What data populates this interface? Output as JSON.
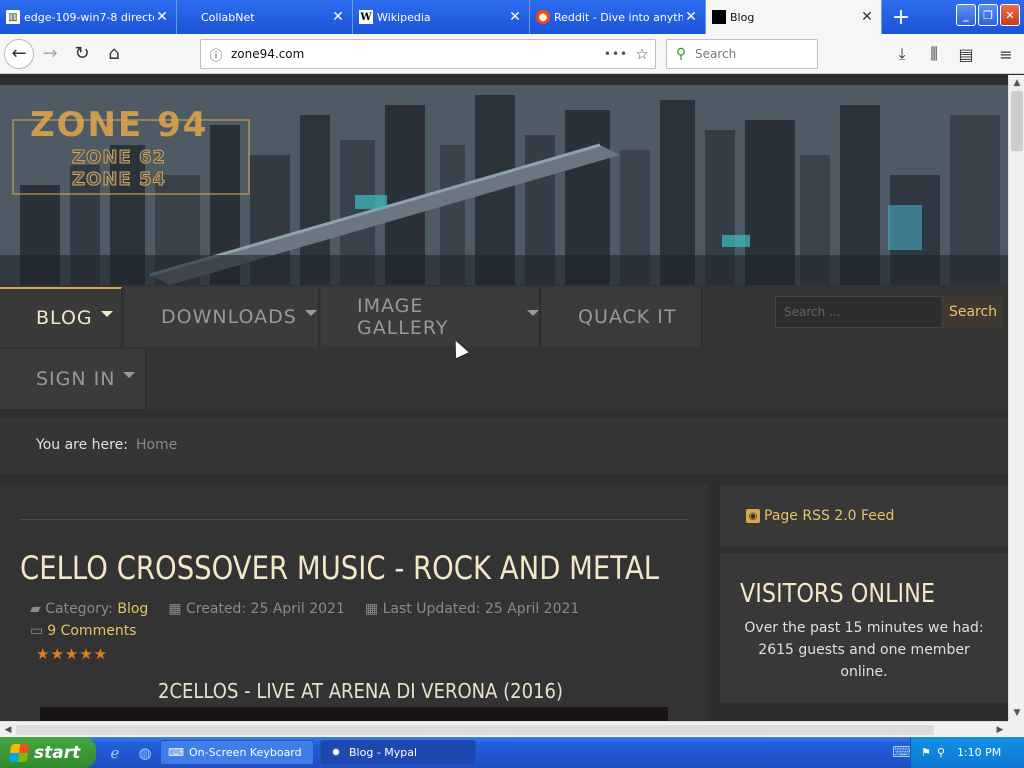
{
  "tabs": [
    {
      "label": "edge-109-win7-8 directo",
      "icon": "library-icon",
      "active": false
    },
    {
      "label": "CollabNet",
      "icon": "blank-page-icon",
      "active": false
    },
    {
      "label": "Wikipedia",
      "icon": "wikipedia-icon",
      "active": false
    },
    {
      "label": "Reddit - Dive into anyth",
      "icon": "reddit-icon",
      "active": false
    },
    {
      "label": "Blog",
      "icon": "black-square-icon",
      "active": true
    }
  ],
  "navbar": {
    "url": "zone94.com",
    "search_placeholder": "Search"
  },
  "banner": {
    "logo_main": "ZONE 94",
    "logo_sub_1": "ZONE 62",
    "logo_sub_2": "ZONE 54"
  },
  "menu": {
    "items": [
      {
        "label": "BLOG",
        "has_caret": true,
        "active": true
      },
      {
        "label": "DOWNLOADS",
        "has_caret": true,
        "active": false
      },
      {
        "label": "IMAGE GALLERY",
        "has_caret": true,
        "active": false
      },
      {
        "label": "QUACK IT",
        "has_caret": false,
        "active": false
      },
      {
        "label": "SIGN IN",
        "has_caret": true,
        "active": false
      }
    ],
    "search_placeholder": "Search ...",
    "search_button": "Search"
  },
  "breadcrumb": {
    "prefix": "You are here:",
    "home": "Home"
  },
  "article": {
    "title": "CELLO CROSSOVER MUSIC - ROCK AND METAL",
    "category_label": "Category:",
    "category": "Blog",
    "created": "Created: 25 April 2021",
    "updated": "Last Updated: 25 April 2021",
    "comments": "9 Comments",
    "stars": "★★★★★",
    "video_title": "2CELLOS - LIVE AT ARENA DI VERONA (2016)"
  },
  "sidebar": {
    "rss": "Page RSS 2.0 Feed",
    "visitors_title": "VISITORS ONLINE",
    "visitors_text": "Over the past 15 minutes we had: 2615 guests and one member online."
  },
  "taskbar": {
    "start": "start",
    "tasks": [
      {
        "label": "On-Screen Keyboard",
        "active": false
      },
      {
        "label": "Blog - Mypal",
        "active": true
      }
    ],
    "clock": "1:10 PM"
  },
  "colors": {
    "accent": "#d9a44e",
    "link": "#e8c16a",
    "page_bg": "#2e2e2e",
    "xp_blue": "#245edb",
    "start_green": "#3c9b3a"
  }
}
